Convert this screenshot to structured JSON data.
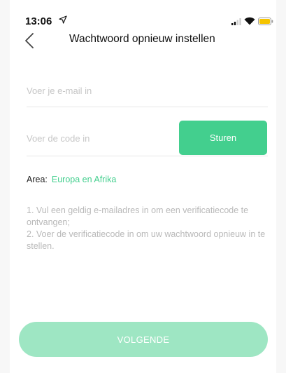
{
  "status_bar": {
    "time": "13:06"
  },
  "header": {
    "title": "Wachtwoord opnieuw instellen"
  },
  "form": {
    "email_placeholder": "Voer je e-mail in",
    "email_value": "",
    "code_placeholder": "Voer de code in",
    "code_value": "",
    "send_label": "Sturen"
  },
  "area": {
    "label": "Area:",
    "value": "Europa en Afrika"
  },
  "instructions": [
    "1. Vul een geldig e-mailadres in om een verificatiecode te ontvangen;",
    "2. Voer de verificatiecode in om uw wachtwoord opnieuw in te stellen."
  ],
  "footer": {
    "next_label": "VOLGENDE"
  },
  "colors": {
    "accent": "#43cf8e",
    "accent_disabled": "#9ee6c3",
    "placeholder": "#c6c6c6",
    "hint": "#b9b9b9",
    "battery": "#f5c400"
  },
  "icons": {
    "back": "chevron-left-icon",
    "location": "location-arrow-icon",
    "signal": "signal-icon",
    "wifi": "wifi-icon",
    "battery": "battery-icon"
  }
}
